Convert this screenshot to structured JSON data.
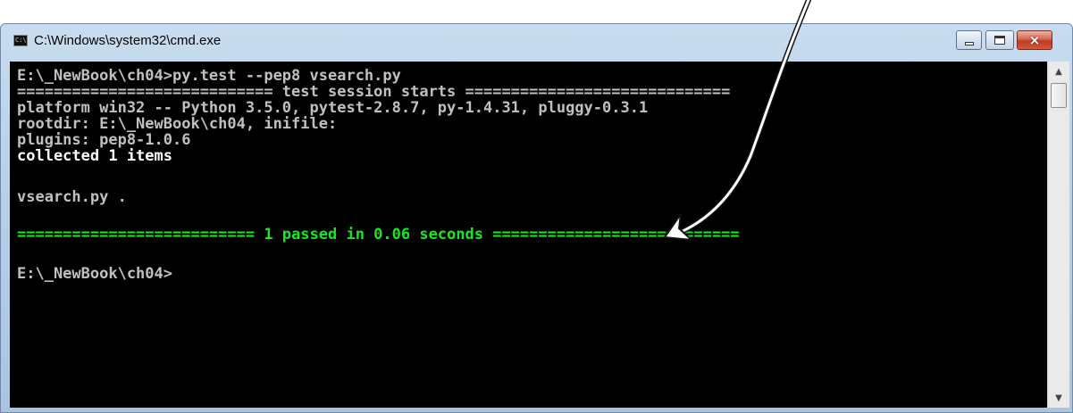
{
  "window": {
    "title": "C:\\Windows\\system32\\cmd.exe",
    "icon_label": "C:\\",
    "buttons": {
      "minimize": "minimize-icon",
      "maximize": "maximize-icon",
      "close": "×"
    }
  },
  "console": {
    "lines": [
      "E:\\_NewBook\\ch04>py.test --pep8 vsearch.py",
      "============================ test session starts =============================",
      "platform win32 -- Python 3.5.0, pytest-2.8.7, py-1.4.31, pluggy-0.3.1",
      "rootdir: E:\\_NewBook\\ch04, inifile:",
      "plugins: pep8-1.0.6",
      "collected 1 items",
      "",
      "vsearch.py .",
      "",
      "========================== 1 passed in 0.06 seconds ===========================",
      "",
      "E:\\_NewBook\\ch04>"
    ]
  },
  "colors": {
    "text_default": "#c0c0c0",
    "text_bold": "#ffffff",
    "text_passed": "#15e81f",
    "background": "#000000"
  }
}
